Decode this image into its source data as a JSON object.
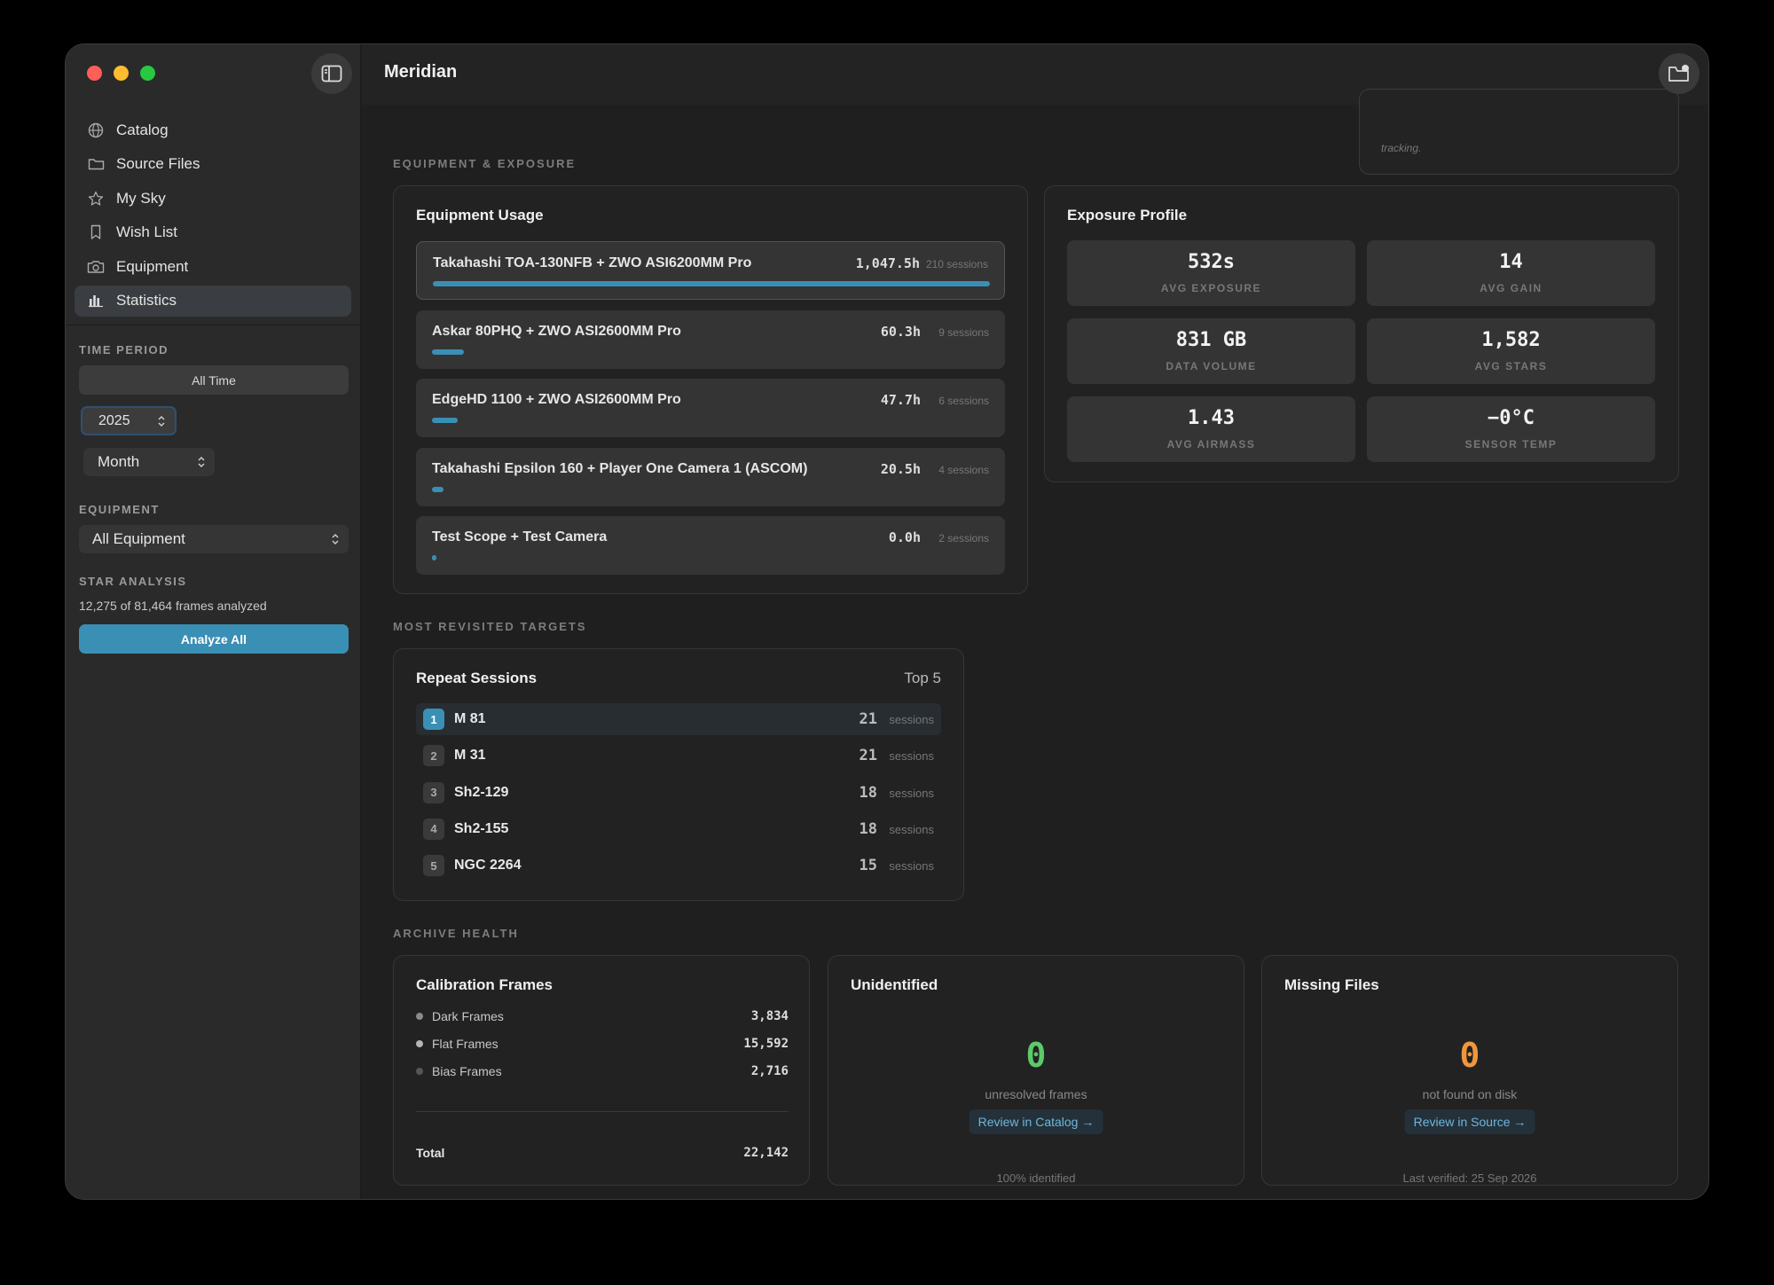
{
  "window": {
    "title": "Meridian"
  },
  "sidebar": {
    "items": [
      {
        "label": "Catalog",
        "icon": "globe-icon"
      },
      {
        "label": "Source Files",
        "icon": "folder-icon"
      },
      {
        "label": "My Sky",
        "icon": "star-icon"
      },
      {
        "label": "Wish List",
        "icon": "bookmark-icon"
      },
      {
        "label": "Equipment",
        "icon": "camera-icon"
      },
      {
        "label": "Statistics",
        "icon": "bar-chart-icon",
        "active": true
      }
    ],
    "time_period": {
      "label": "TIME PERIOD",
      "all_time": "All Time",
      "year": "2025",
      "granularity": "Month"
    },
    "equipment": {
      "label": "EQUIPMENT",
      "selected": "All Equipment"
    },
    "star_analysis": {
      "label": "STAR ANALYSIS",
      "progress_text": "12,275 of 81,464 frames analyzed",
      "button": "Analyze All"
    }
  },
  "top_fragment": {
    "text": "tracking."
  },
  "equipment_exposure": {
    "section_label": "EQUIPMENT & EXPOSURE",
    "usage": {
      "title": "Equipment Usage",
      "items": [
        {
          "name": "Takahashi TOA-130NFB + ZWO ASI6200MM Pro",
          "hours": "1,047.5h",
          "sessions": "210 sessions",
          "fraction": 1.0
        },
        {
          "name": "Askar 80PHQ + ZWO ASI2600MM Pro",
          "hours": "60.3h",
          "sessions": "9 sessions",
          "fraction": 0.058
        },
        {
          "name": "EdgeHD 1100 + ZWO ASI2600MM Pro",
          "hours": "47.7h",
          "sessions": "6 sessions",
          "fraction": 0.046
        },
        {
          "name": "Takahashi Epsilon 160 + Player One Camera 1 (ASCOM)",
          "hours": "20.5h",
          "sessions": "4 sessions",
          "fraction": 0.02
        },
        {
          "name": "Test Scope + Test Camera",
          "hours": "0.0h",
          "sessions": "2 sessions",
          "fraction": 0.0
        }
      ]
    },
    "exposure": {
      "title": "Exposure Profile",
      "stats": [
        {
          "value": "532s",
          "label": "AVG EXPOSURE"
        },
        {
          "value": "14",
          "label": "AVG GAIN"
        },
        {
          "value": "831 GB",
          "label": "DATA VOLUME"
        },
        {
          "value": "1,582",
          "label": "AVG STARS"
        },
        {
          "value": "1.43",
          "label": "AVG AIRMASS"
        },
        {
          "value": "−0°C",
          "label": "SENSOR TEMP"
        }
      ]
    }
  },
  "revisited": {
    "section_label": "MOST REVISITED TARGETS",
    "title": "Repeat Sessions",
    "badge": "Top 5",
    "rows": [
      {
        "rank": "1",
        "name": "M 81",
        "count": "21",
        "unit": "sessions"
      },
      {
        "rank": "2",
        "name": "M 31",
        "count": "21",
        "unit": "sessions"
      },
      {
        "rank": "3",
        "name": "Sh2-129",
        "count": "18",
        "unit": "sessions"
      },
      {
        "rank": "4",
        "name": "Sh2-155",
        "count": "18",
        "unit": "sessions"
      },
      {
        "rank": "5",
        "name": "NGC 2264",
        "count": "15",
        "unit": "sessions"
      }
    ]
  },
  "archive": {
    "section_label": "ARCHIVE HEALTH",
    "calibration": {
      "title": "Calibration Frames",
      "rows": [
        {
          "name": "Dark Frames",
          "value": "3,834"
        },
        {
          "name": "Flat Frames",
          "value": "15,592"
        },
        {
          "name": "Bias Frames",
          "value": "2,716"
        }
      ],
      "total_label": "Total",
      "total_value": "22,142"
    },
    "unidentified": {
      "title": "Unidentified",
      "value": "0",
      "sub": "unresolved frames",
      "link": "Review in Catalog →",
      "footer": "100% identified"
    },
    "missing": {
      "title": "Missing Files",
      "value": "0",
      "sub": "not found on disk",
      "link": "Review in Source →",
      "footer": "Last verified: 25 Sep 2026"
    }
  },
  "colors": {
    "accent": "#3a8fb5",
    "ok_green": "#5cc96a",
    "warn_orange": "#f0963c",
    "traffic_red": "#ff5f57",
    "traffic_yellow": "#febc2e",
    "traffic_green": "#28c840"
  }
}
